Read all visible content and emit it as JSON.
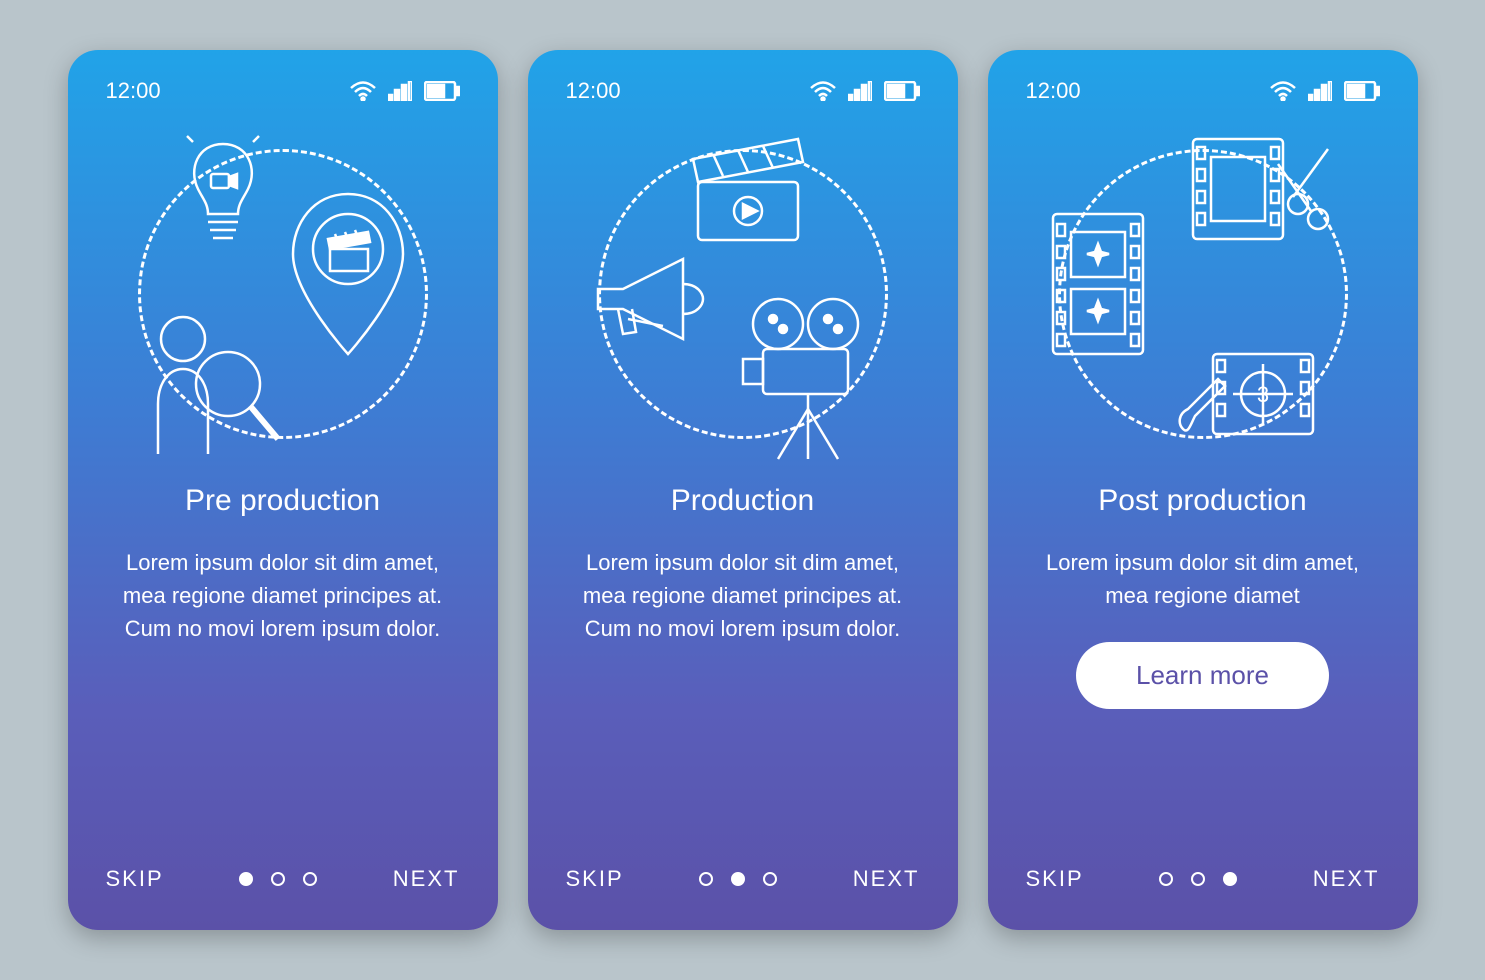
{
  "status_time": "12:00",
  "nav": {
    "skip": "SKIP",
    "next": "NEXT"
  },
  "screens": [
    {
      "title": "Pre production",
      "body": "Lorem ipsum dolor sit dim amet, mea regione diamet principes at. Cum no movi lorem ipsum dolor.",
      "active_dot": 0,
      "show_learn_more": false
    },
    {
      "title": "Production",
      "body": "Lorem ipsum dolor sit dim amet, mea regione diamet principes at. Cum no movi lorem ipsum dolor.",
      "active_dot": 1,
      "show_learn_more": false
    },
    {
      "title": "Post production",
      "body": "Lorem ipsum dolor sit dim amet, mea regione diamet",
      "active_dot": 2,
      "show_learn_more": true
    }
  ],
  "learn_more_label": "Learn more"
}
